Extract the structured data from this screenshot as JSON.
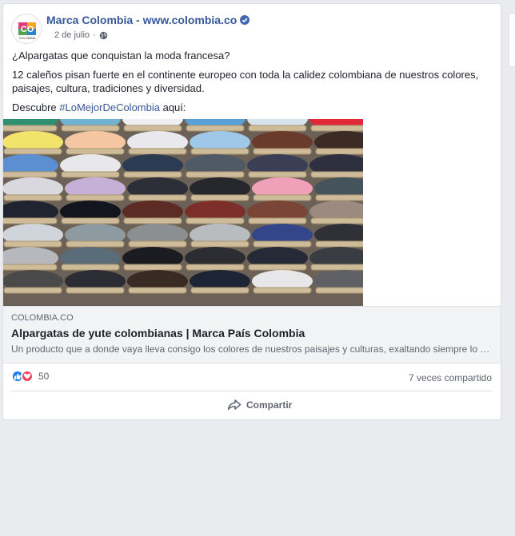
{
  "post": {
    "page_name": "Marca Colombia - www.colombia.co",
    "date": "2 de julio",
    "dot": "·",
    "text": {
      "line1": "¿Alpargatas que conquistan la moda francesa?",
      "line2": "12 caleños pisan fuerte en el continente europeo con toda la calidez colombiana de nuestros colores, paisajes, cultura, tradiciones y diversidad.",
      "line3_prefix": "Descubre ",
      "hashtag": "#LoMejorDeColombia",
      "line3_suffix": " aquí:"
    },
    "avatar_logo": "CO",
    "avatar_sub": "COLOMBIA"
  },
  "link_preview": {
    "domain": "COLOMBIA.CO",
    "title": "Alpargatas de yute colombianas | Marca País Colombia",
    "description": "Un producto que a donde vaya lleva consigo los colores de nuestros paisajes y culturas, exaltando siempre lo mejor de Colombia."
  },
  "engagement": {
    "reaction_count": "50",
    "shares": "7 veces compartido",
    "share_button_label": "Compartir"
  },
  "icons": {
    "verified": "verified-badge-icon",
    "globe": "globe-icon",
    "like": "like-reaction-icon",
    "love": "love-reaction-icon",
    "share": "share-arrow-icon"
  },
  "colors": {
    "link_blue": "#385898",
    "like_blue": "#1877f2",
    "love_red": "#f33e58"
  }
}
